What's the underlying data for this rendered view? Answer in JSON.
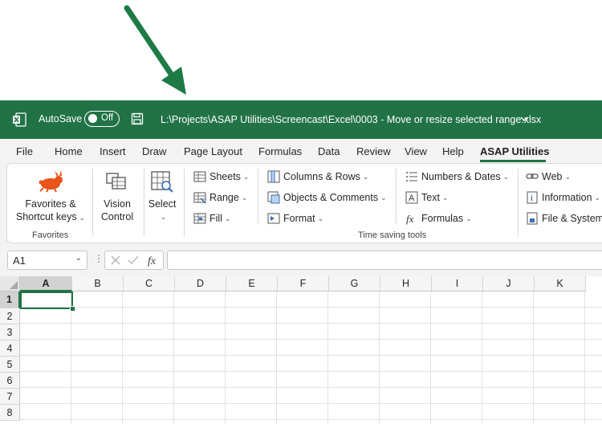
{
  "titlebar": {
    "autosave_label": "AutoSave",
    "autosave_state": "Off",
    "file_path": "L:\\Projects\\ASAP Utilities\\Screencast\\Excel\\0003 - Move or resize selected range.xlsx",
    "bg_color": "#217346"
  },
  "menu": {
    "tabs": [
      "File",
      "Home",
      "Insert",
      "Draw",
      "Page Layout",
      "Formulas",
      "Data",
      "Review",
      "View",
      "Help",
      "ASAP Utilities"
    ],
    "active_tab": "ASAP Utilities"
  },
  "ribbon": {
    "favorites": {
      "line1": "Favorites &",
      "line2": "Shortcut keys",
      "group_label": "Favorites"
    },
    "vision": {
      "line1": "Vision",
      "line2": "Control"
    },
    "select": {
      "label": "Select"
    },
    "col1": [
      "Sheets",
      "Range",
      "Fill"
    ],
    "col2": [
      "Columns & Rows",
      "Objects & Comments",
      "Format"
    ],
    "col3": [
      "Numbers & Dates",
      "Text",
      "Formulas"
    ],
    "col4": [
      "Web",
      "Information",
      "File & System"
    ],
    "time_saving_label": "Time saving tools"
  },
  "formula_bar": {
    "name_box": "A1",
    "formula": ""
  },
  "grid": {
    "columns": [
      "A",
      "B",
      "C",
      "D",
      "E",
      "F",
      "G",
      "H",
      "I",
      "J",
      "K"
    ],
    "rows": [
      "1",
      "2",
      "3",
      "4",
      "5",
      "6",
      "7",
      "8"
    ],
    "active_cell": "A1"
  },
  "colors": {
    "excel_green": "#217346",
    "accent_orange": "#e8541a"
  }
}
